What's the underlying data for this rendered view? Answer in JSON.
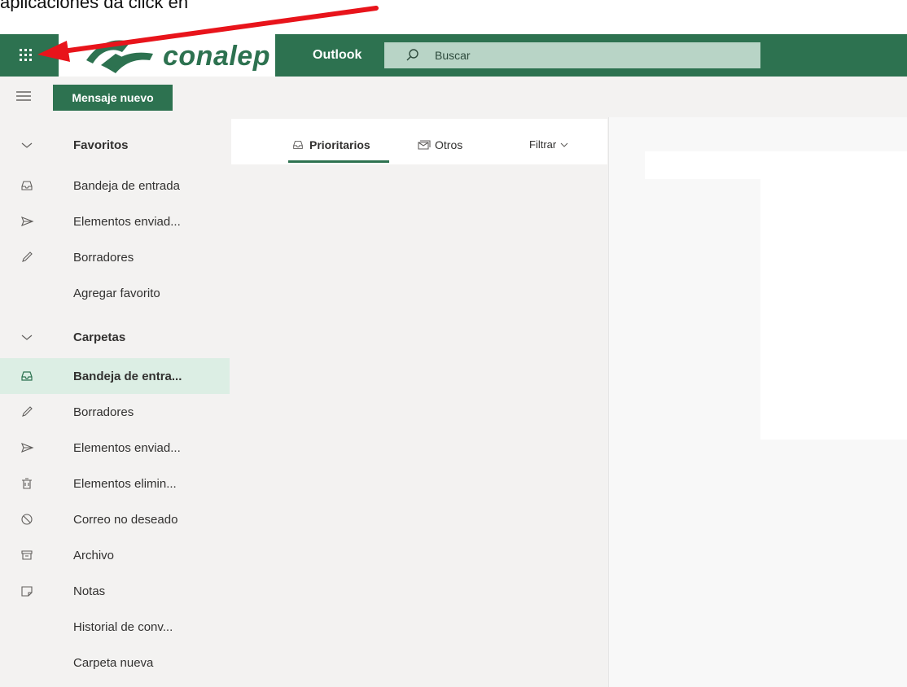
{
  "caption": "aplicaciones da click en",
  "header": {
    "logo_text": "conalep",
    "app_name": "Outlook",
    "search_placeholder": "Buscar"
  },
  "command_bar": {
    "new_message_label": "Mensaje nuevo"
  },
  "sidebar": {
    "favorites_header": "Favoritos",
    "favorites": [
      {
        "label": "Bandeja de entrada",
        "icon": "inbox-icon"
      },
      {
        "label": "Elementos enviad...",
        "icon": "send-icon"
      },
      {
        "label": "Borradores",
        "icon": "pencil-icon"
      },
      {
        "label": "Agregar favorito",
        "icon": ""
      }
    ],
    "folders_header": "Carpetas",
    "folders": [
      {
        "label": "Bandeja de entra...",
        "icon": "inbox-icon",
        "selected": true
      },
      {
        "label": "Borradores",
        "icon": "pencil-icon"
      },
      {
        "label": "Elementos enviad...",
        "icon": "send-icon"
      },
      {
        "label": "Elementos elimin...",
        "icon": "trash-icon"
      },
      {
        "label": "Correo no deseado",
        "icon": "blocked-icon"
      },
      {
        "label": "Archivo",
        "icon": "archive-icon"
      },
      {
        "label": "Notas",
        "icon": "note-icon"
      },
      {
        "label": "Historial de conv...",
        "icon": ""
      },
      {
        "label": "Carpeta nueva",
        "icon": ""
      }
    ]
  },
  "message_list": {
    "tab_focused": "Prioritarios",
    "tab_other": "Otros",
    "filter_label": "Filtrar"
  },
  "colors": {
    "brand": "#2d7250",
    "search_bg": "#b8d4c6",
    "selected_row": "#dceee4",
    "arrow": "#e8141b"
  }
}
